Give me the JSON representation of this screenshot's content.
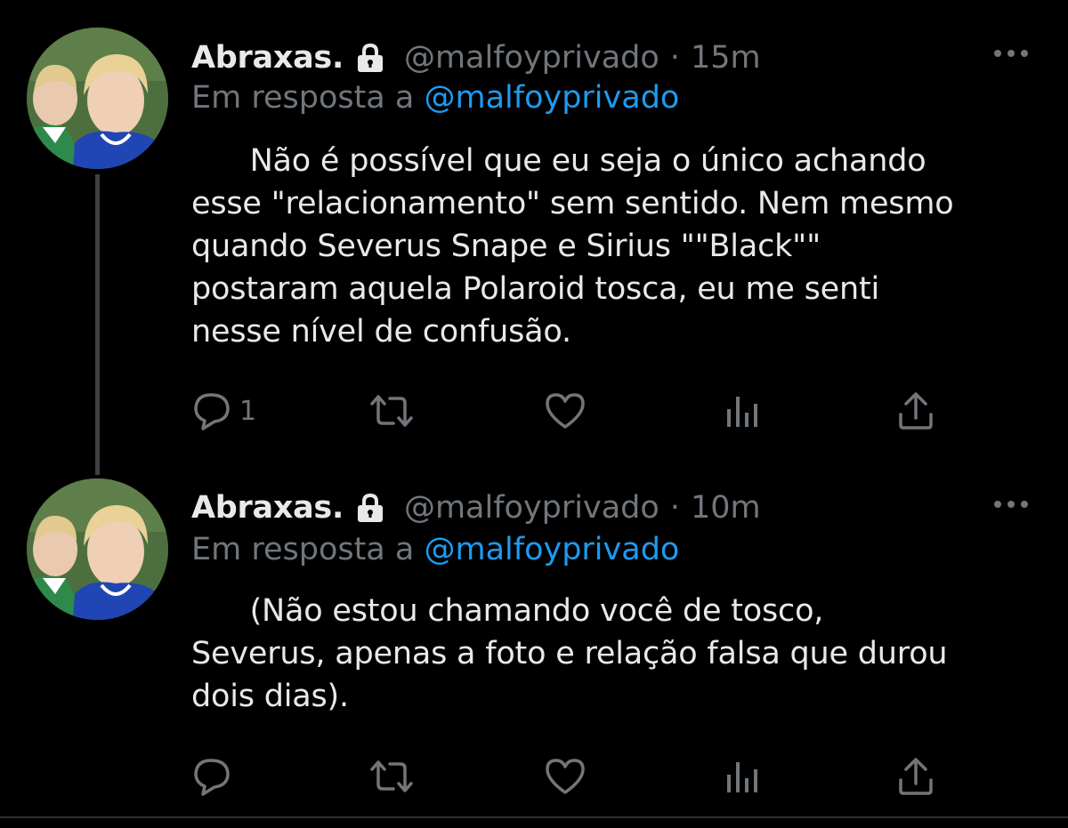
{
  "colors": {
    "background": "#000000",
    "text": "#e7e9ea",
    "secondary": "#71767b",
    "link": "#1d9bf0",
    "thread_line": "#3e4144"
  },
  "tweets": [
    {
      "display_name": "Abraxas.",
      "locked_icon": "lock-icon",
      "handle": "@malfoyprivado",
      "separator": "·",
      "time": "15m",
      "reply_prefix": "Em resposta a",
      "reply_to": "@malfoyprivado",
      "text": "      Não é possível que eu seja o único achando\nesse \"relacionamento\" sem sentido. Nem mesmo\nquando Severus Snape e Sirius \"\"Black\"\"\npostaram aquela Polaroid tosca, eu me senti\nnesse nível de confusão.",
      "reply_count": "1",
      "icons": [
        "reply-icon",
        "retweet-icon",
        "like-icon",
        "analytics-icon",
        "share-icon",
        "more-icon"
      ]
    },
    {
      "display_name": "Abraxas.",
      "locked_icon": "lock-icon",
      "handle": "@malfoyprivado",
      "separator": "·",
      "time": "10m",
      "reply_prefix": "Em resposta a",
      "reply_to": "@malfoyprivado",
      "text": "      (Não estou chamando você de tosco,\nSeverus, apenas a foto e relação falsa que durou\ndois dias).",
      "reply_count": "",
      "icons": [
        "reply-icon",
        "retweet-icon",
        "like-icon",
        "analytics-icon",
        "share-icon",
        "more-icon"
      ]
    }
  ]
}
